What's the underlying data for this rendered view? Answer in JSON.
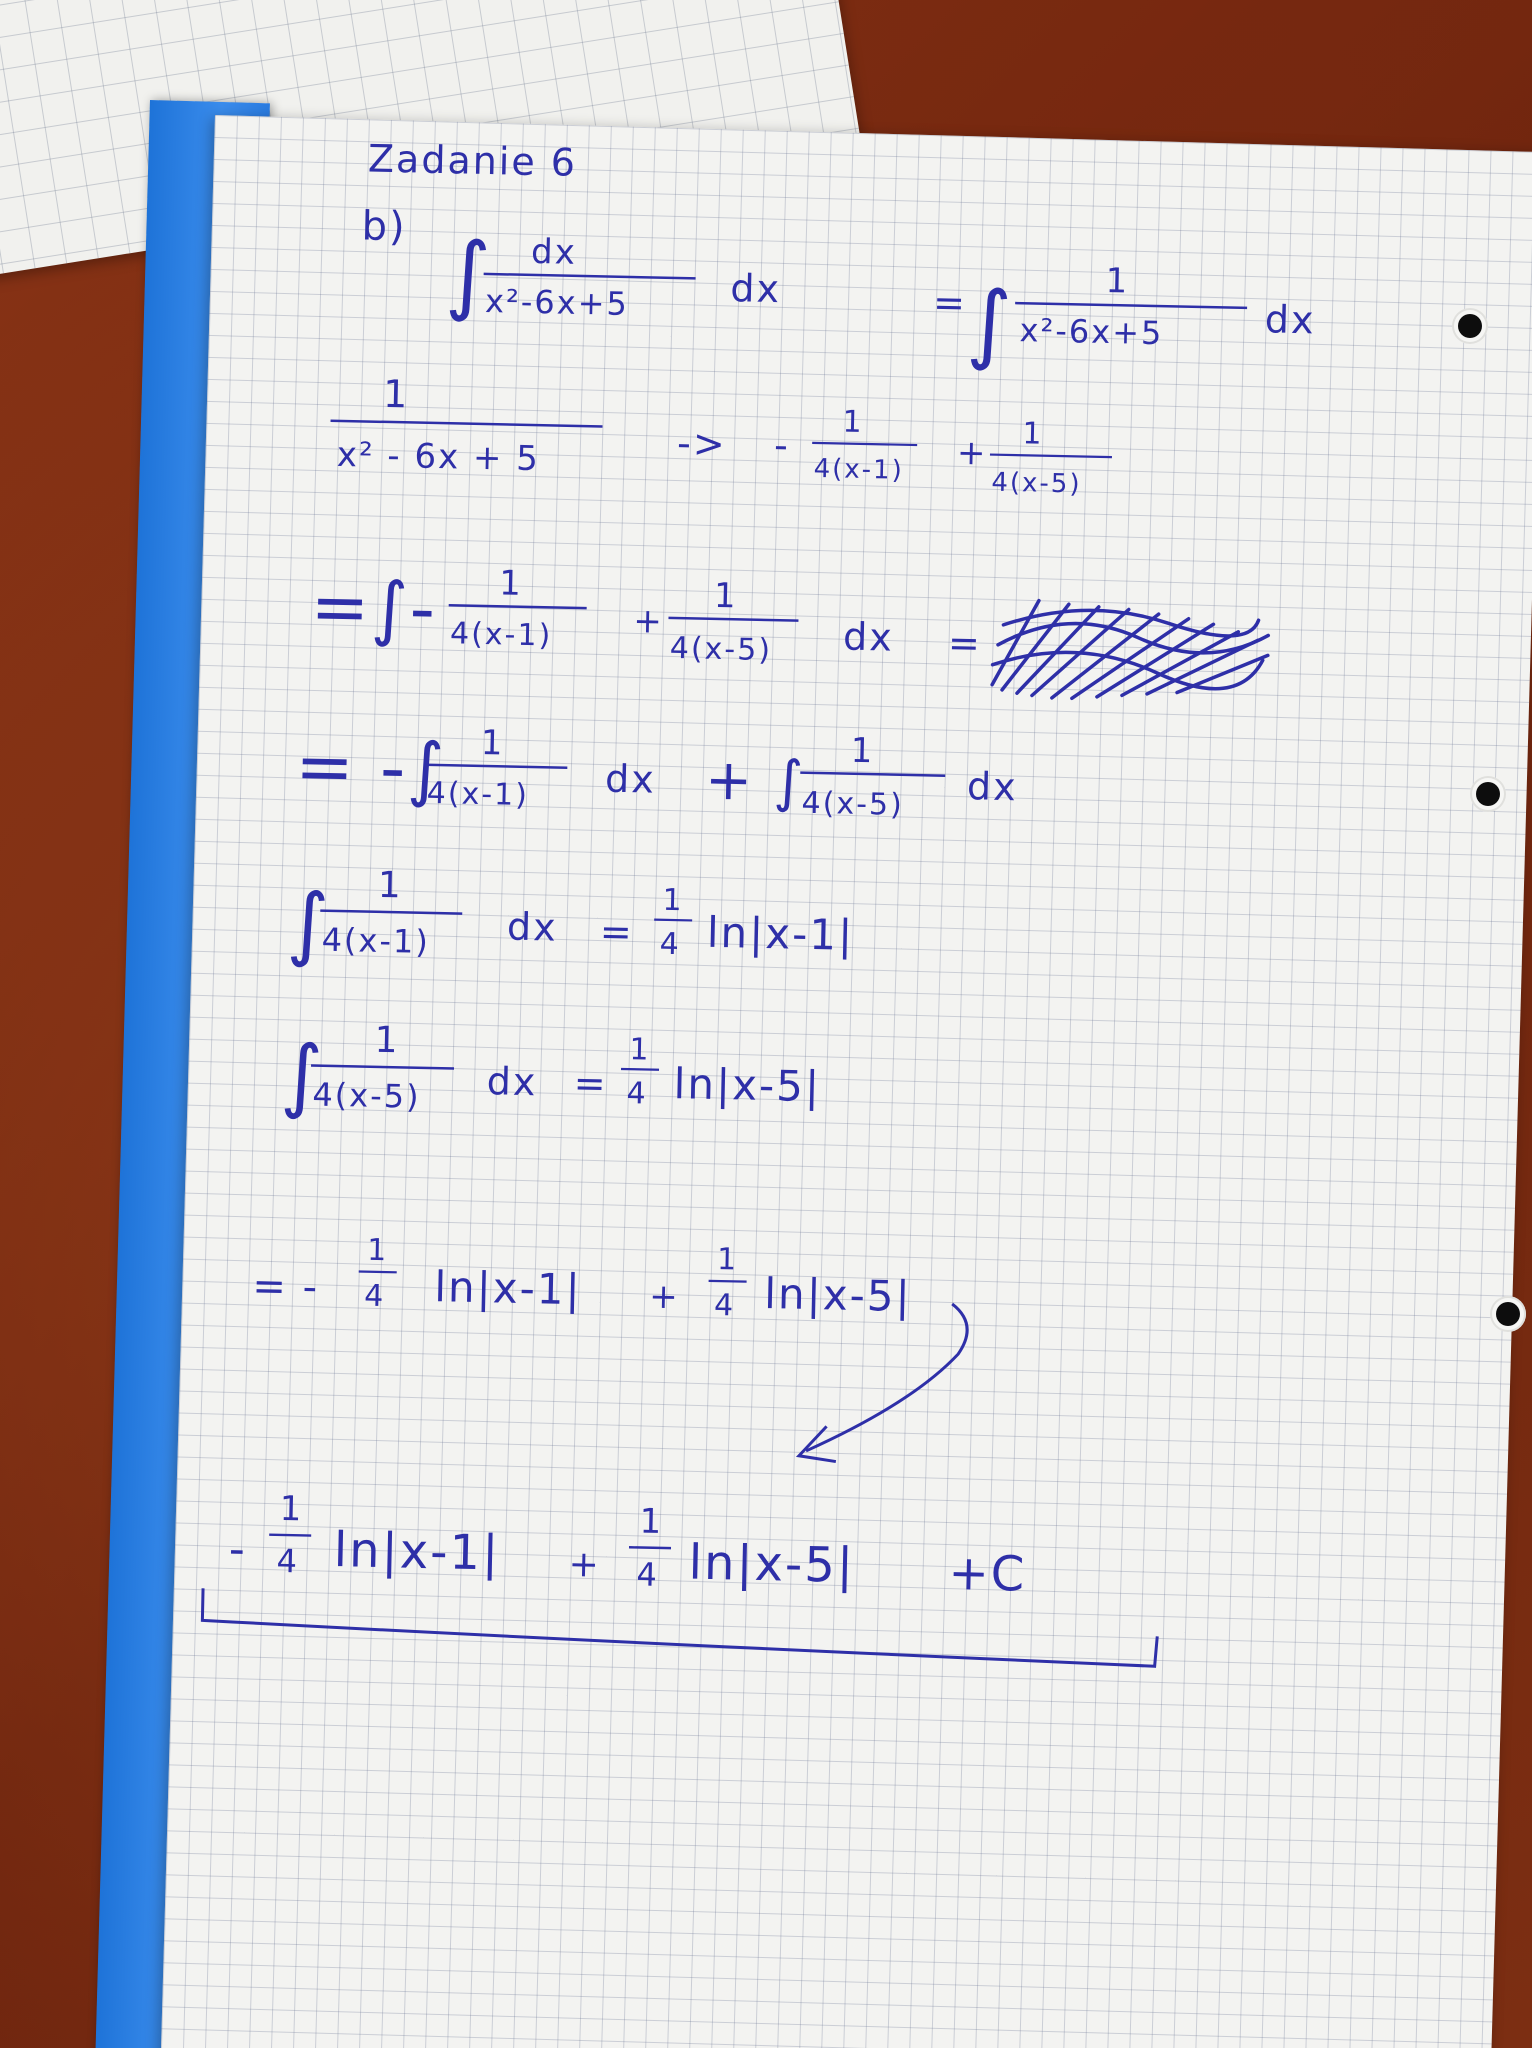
{
  "heading": "Zadanie 6",
  "part": "b)",
  "line1": {
    "integral_sign": "∫",
    "frac1_num": "dx",
    "frac1_den": "x²-6x+5",
    "dx1": "dx",
    "eq": "=",
    "frac2_num": "1",
    "frac2_den": "x²-6x+5",
    "dx2": "dx"
  },
  "line2": {
    "frac_num": "1",
    "frac_den": "x² - 6x + 5",
    "arrow": "->",
    "minus": "-",
    "t1_num": "1",
    "t1_den": "4(x-1)",
    "plus": "+",
    "t2_num": "1",
    "t2_den": "4(x-5)"
  },
  "line3": {
    "lead": "=∫-",
    "t1_num": "1",
    "t1_den": "4(x-1)",
    "plus": "+",
    "t2_num": "1",
    "t2_den": "4(x-5)",
    "dx": "dx",
    "eq": "="
  },
  "line4": {
    "lead": "= -∫",
    "t1_num": "1",
    "t1_den": "4(x-1)",
    "dx1": "dx",
    "plus": "+ ∫",
    "t2_num": "1",
    "t2_den": "4(x-5)",
    "dx2": "dx"
  },
  "line5": {
    "integral_sign": "∫",
    "frac_num": "1",
    "frac_den": "4(x-1)",
    "dx": "dx",
    "eq": "=",
    "coef_num": "1",
    "coef_den": "4",
    "ln_expr": "ln|x-1|"
  },
  "line6": {
    "integral_sign": "∫",
    "frac_num": "1",
    "frac_den": "4(x-5)",
    "dx": "dx",
    "eq": "=",
    "coef_num": "1",
    "coef_den": "4",
    "ln_expr": "ln|x-5|"
  },
  "line7": {
    "lead": "= -",
    "c1_num": "1",
    "c1_den": "4",
    "ln1": "ln|x-1|",
    "plus": "+",
    "c2_num": "1",
    "c2_den": "4",
    "ln2": "ln|x-5|"
  },
  "final": {
    "lead": "-",
    "c1_num": "1",
    "c1_den": "4",
    "ln1": "ln|x-1|",
    "plus": "+",
    "c2_num": "1",
    "c2_den": "4",
    "ln2": "ln|x-5|",
    "const": "+C"
  },
  "colors": {
    "ink": "#2e2fa8",
    "binder": "#2a7be0",
    "desk": "#7a2c14",
    "paper": "#f3f3f1"
  }
}
